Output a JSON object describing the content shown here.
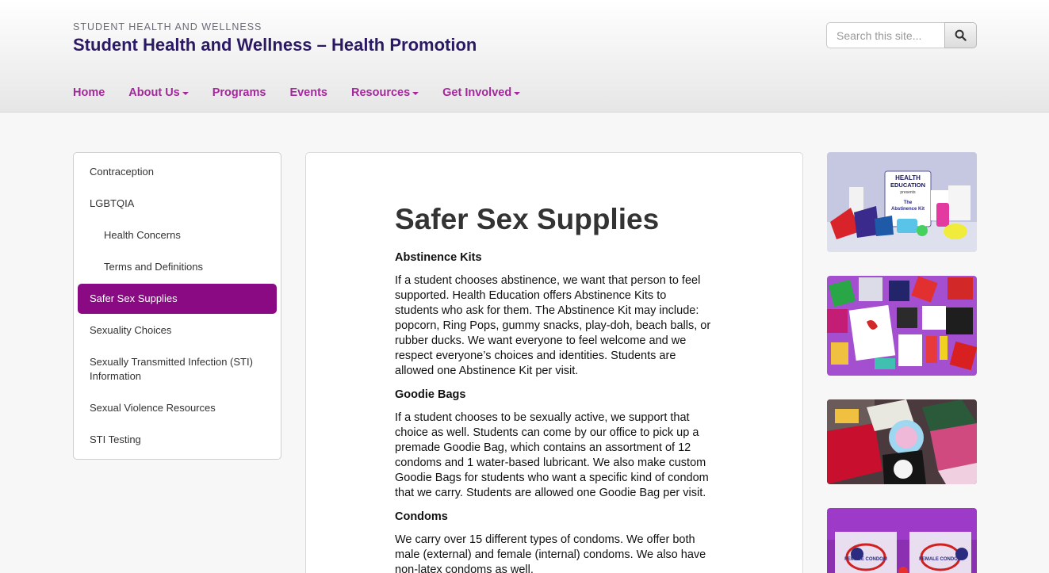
{
  "header": {
    "kicker": "STUDENT HEALTH AND WELLNESS",
    "title": "Student Health and Wellness – Health Promotion",
    "search_placeholder": "Search this site...",
    "search_icon": "search-icon"
  },
  "nav": {
    "items": [
      {
        "label": "Home",
        "dropdown": false
      },
      {
        "label": "About Us",
        "dropdown": true
      },
      {
        "label": "Programs",
        "dropdown": false
      },
      {
        "label": "Events",
        "dropdown": false
      },
      {
        "label": "Resources",
        "dropdown": true
      },
      {
        "label": "Get Involved",
        "dropdown": true
      }
    ]
  },
  "sidebar": {
    "items": [
      {
        "label": "Contraception"
      },
      {
        "label": "LGBTQIA"
      },
      {
        "label": "Health Concerns"
      },
      {
        "label": "Terms and Definitions"
      },
      {
        "label": "Safer Sex Supplies"
      },
      {
        "label": "Sexuality Choices"
      },
      {
        "label": "Sexually Transmitted Infection (STI) Information"
      },
      {
        "label": "Sexual Violence Resources"
      },
      {
        "label": "STI Testing"
      }
    ]
  },
  "main": {
    "title": "Safer Sex Supplies",
    "sections": [
      {
        "heading": "Abstinence Kits",
        "body": "If a student chooses abstinence, we want that person to feel supported. Health Education offers Abstinence Kits to students who ask for them. The Abstinence Kit may include: popcorn, Ring Pops, gummy snacks, play-doh, beach balls, or rubber ducks. We want everyone to feel welcome and we respect everyone’s choices and identities. Students are allowed one Abstinence Kit per visit."
      },
      {
        "heading": "Goodie Bags",
        "body": "If a student chooses to be sexually active, we support that choice as well. Students can come by our office to pick up a premade Goodie Bag, which contains an assortment of 12 condoms and 1 water-based lubricant. We also make custom Goodie Bags for students who want a specific kind of condom that we carry. Students are allowed one Goodie Bag per visit."
      },
      {
        "heading": "Condoms",
        "body": "We carry over 15 different types of condoms. We offer both male (external) and female (internal) condoms. We also have non-latex condoms as well."
      }
    ]
  },
  "images": {
    "kit_sign": {
      "line1": "HEALTH",
      "line2": "EDUCATION",
      "line3": "presents",
      "line4": "The",
      "line5": "Abstinence Kit"
    },
    "condom_labels": {
      "left": "FEMALE CONDOM",
      "right": "FEMALE CONDOM"
    }
  },
  "colors": {
    "brand_title": "#2b1a63",
    "nav_link": "#a3289b",
    "sidebar_active": "#8a0a84"
  }
}
